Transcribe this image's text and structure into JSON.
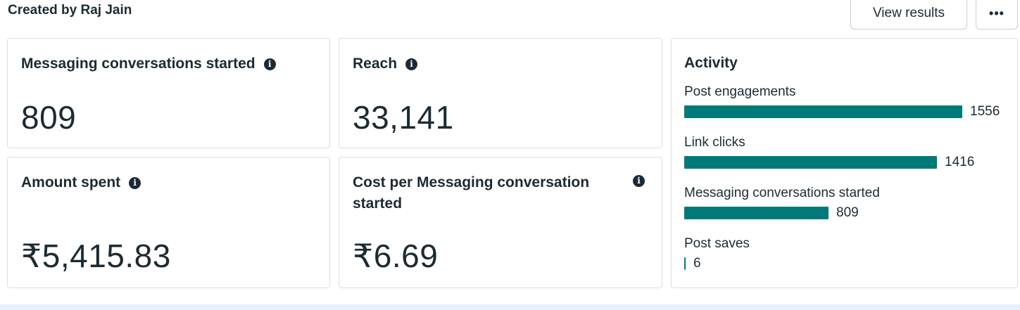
{
  "header": {
    "created_by": "Created by Raj Jain",
    "view_results_label": "View results",
    "more_label": "•••"
  },
  "metrics": [
    {
      "title": "Messaging conversations started",
      "value": "809"
    },
    {
      "title": "Reach",
      "value": "33,141"
    },
    {
      "title": "Amount spent",
      "value": "₹5,415.83"
    },
    {
      "title": "Cost per Messaging conversation started",
      "value": "₹6.69"
    }
  ],
  "info_icon_glyph": "i",
  "activity": {
    "title": "Activity",
    "bar_color": "#007a78",
    "max_value": 1556,
    "items": [
      {
        "label": "Post engagements",
        "value": 1556,
        "count_text": "1556"
      },
      {
        "label": "Link clicks",
        "value": 1416,
        "count_text": "1416"
      },
      {
        "label": "Messaging conversations started",
        "value": 809,
        "count_text": "809"
      },
      {
        "label": "Post saves",
        "value": 6,
        "count_text": "6"
      }
    ]
  }
}
